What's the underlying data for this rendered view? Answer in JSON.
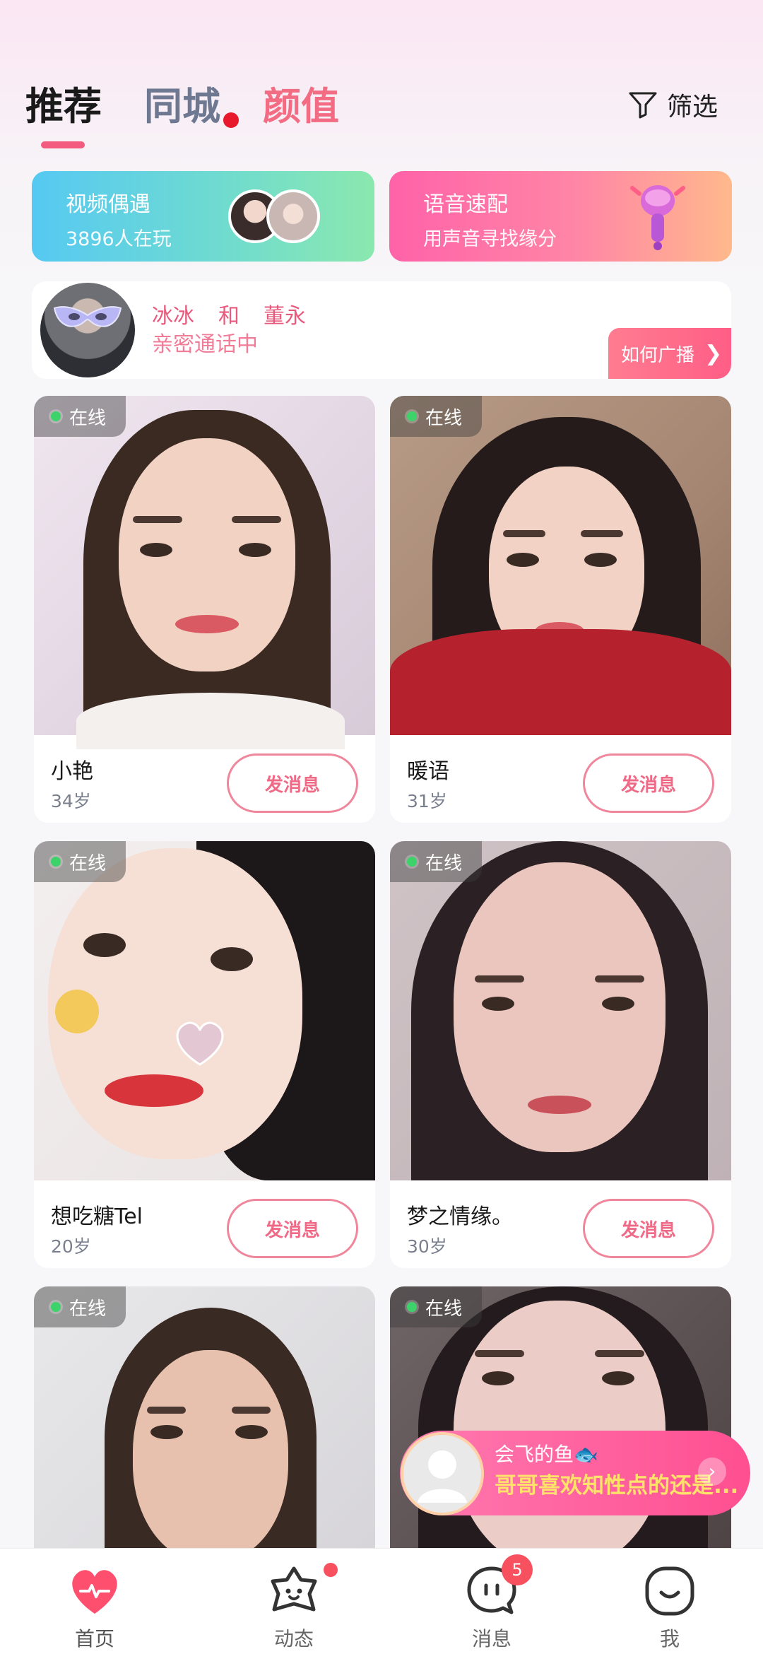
{
  "header": {
    "tabs": [
      "推荐",
      "同城",
      "颜值"
    ],
    "filter_label": "筛选"
  },
  "banners": {
    "video": {
      "title": "视频偶遇",
      "subtitle": "3896人在玩"
    },
    "voice": {
      "title": "语音速配",
      "subtitle": "用声音寻找缘分"
    }
  },
  "live": {
    "name_a": "冰冰",
    "conj": "和",
    "name_b": "董永",
    "status": "亲密通话中",
    "how_label": "如何广播"
  },
  "online_label": "在线",
  "message_label": "发消息",
  "profiles": [
    {
      "name": "小艳",
      "age": "34岁"
    },
    {
      "name": "暖语",
      "age": "31岁"
    },
    {
      "name": "想吃糖Tel",
      "age": "20岁"
    },
    {
      "name": "梦之情缘。",
      "age": "30岁"
    }
  ],
  "toast": {
    "name": "会飞的鱼🐟",
    "text": "哥哥喜欢知性点的还是..."
  },
  "nav": {
    "items": [
      "首页",
      "动态",
      "消息",
      "我"
    ],
    "message_badge": "5"
  },
  "colors": {
    "accent": "#f35b7f",
    "online": "#3dd36a",
    "button_border": "#f0869b"
  }
}
